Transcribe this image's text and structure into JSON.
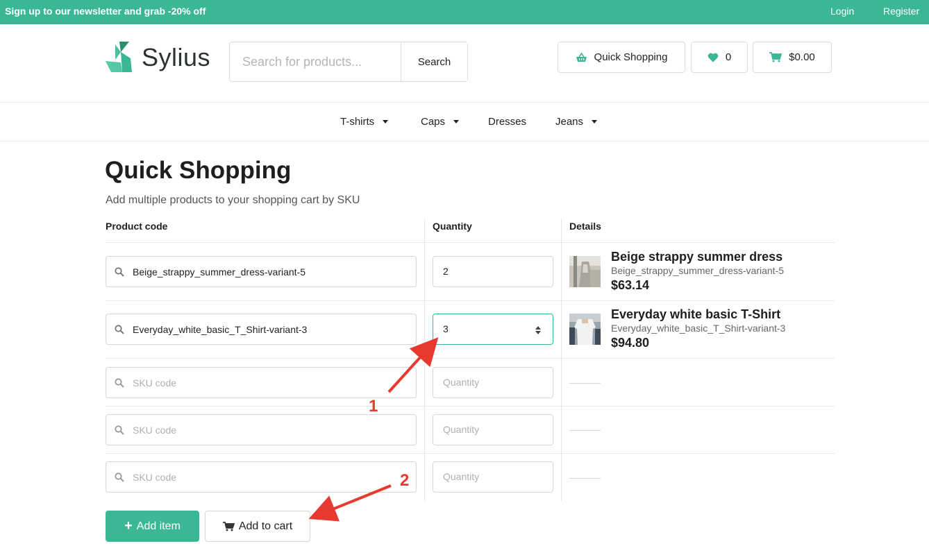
{
  "topbar": {
    "promo": "Sign up to our newsletter and grab -20% off",
    "login": "Login",
    "register": "Register",
    "color": "#3ab795"
  },
  "header": {
    "logo_text": "Sylius",
    "search_placeholder": "Search for products...",
    "search_button": "Search",
    "quick_shopping": "Quick Shopping",
    "quick_shopping_icon": "basket-icon",
    "wishlist_count": "0",
    "wishlist_icon": "heart-icon",
    "cart_total": "$0.00",
    "cart_icon": "cart-icon"
  },
  "nav": {
    "items": [
      {
        "label": "T-shirts",
        "dropdown": true
      },
      {
        "label": "Caps",
        "dropdown": true
      },
      {
        "label": "Dresses",
        "dropdown": false
      },
      {
        "label": "Jeans",
        "dropdown": true
      }
    ]
  },
  "page": {
    "title": "Quick Shopping",
    "subtitle": "Add multiple products to your shopping cart by SKU"
  },
  "table": {
    "headers": [
      "Product code",
      "Quantity",
      "Details"
    ],
    "sku_placeholder": "SKU code",
    "qty_placeholder": "Quantity",
    "rows": [
      {
        "sku": "Beige_strappy_summer_dress-variant-5",
        "qty": "2",
        "name": "Beige strappy summer dress",
        "variant": "Beige_strappy_summer_dress-variant-5",
        "price": "$63.14"
      },
      {
        "sku": "Everyday_white_basic_T_Shirt-variant-3",
        "qty": "3",
        "name": "Everyday white basic T-Shirt",
        "variant": "Everyday_white_basic_T_Shirt-variant-3",
        "price": "$94.80"
      },
      {
        "sku": "",
        "qty": ""
      },
      {
        "sku": "",
        "qty": ""
      },
      {
        "sku": "",
        "qty": ""
      }
    ]
  },
  "actions": {
    "add_item": "Add item",
    "add_to_cart": "Add to cart"
  },
  "annotations": {
    "step1": "1",
    "step2": "2",
    "color": "#e8392e"
  }
}
